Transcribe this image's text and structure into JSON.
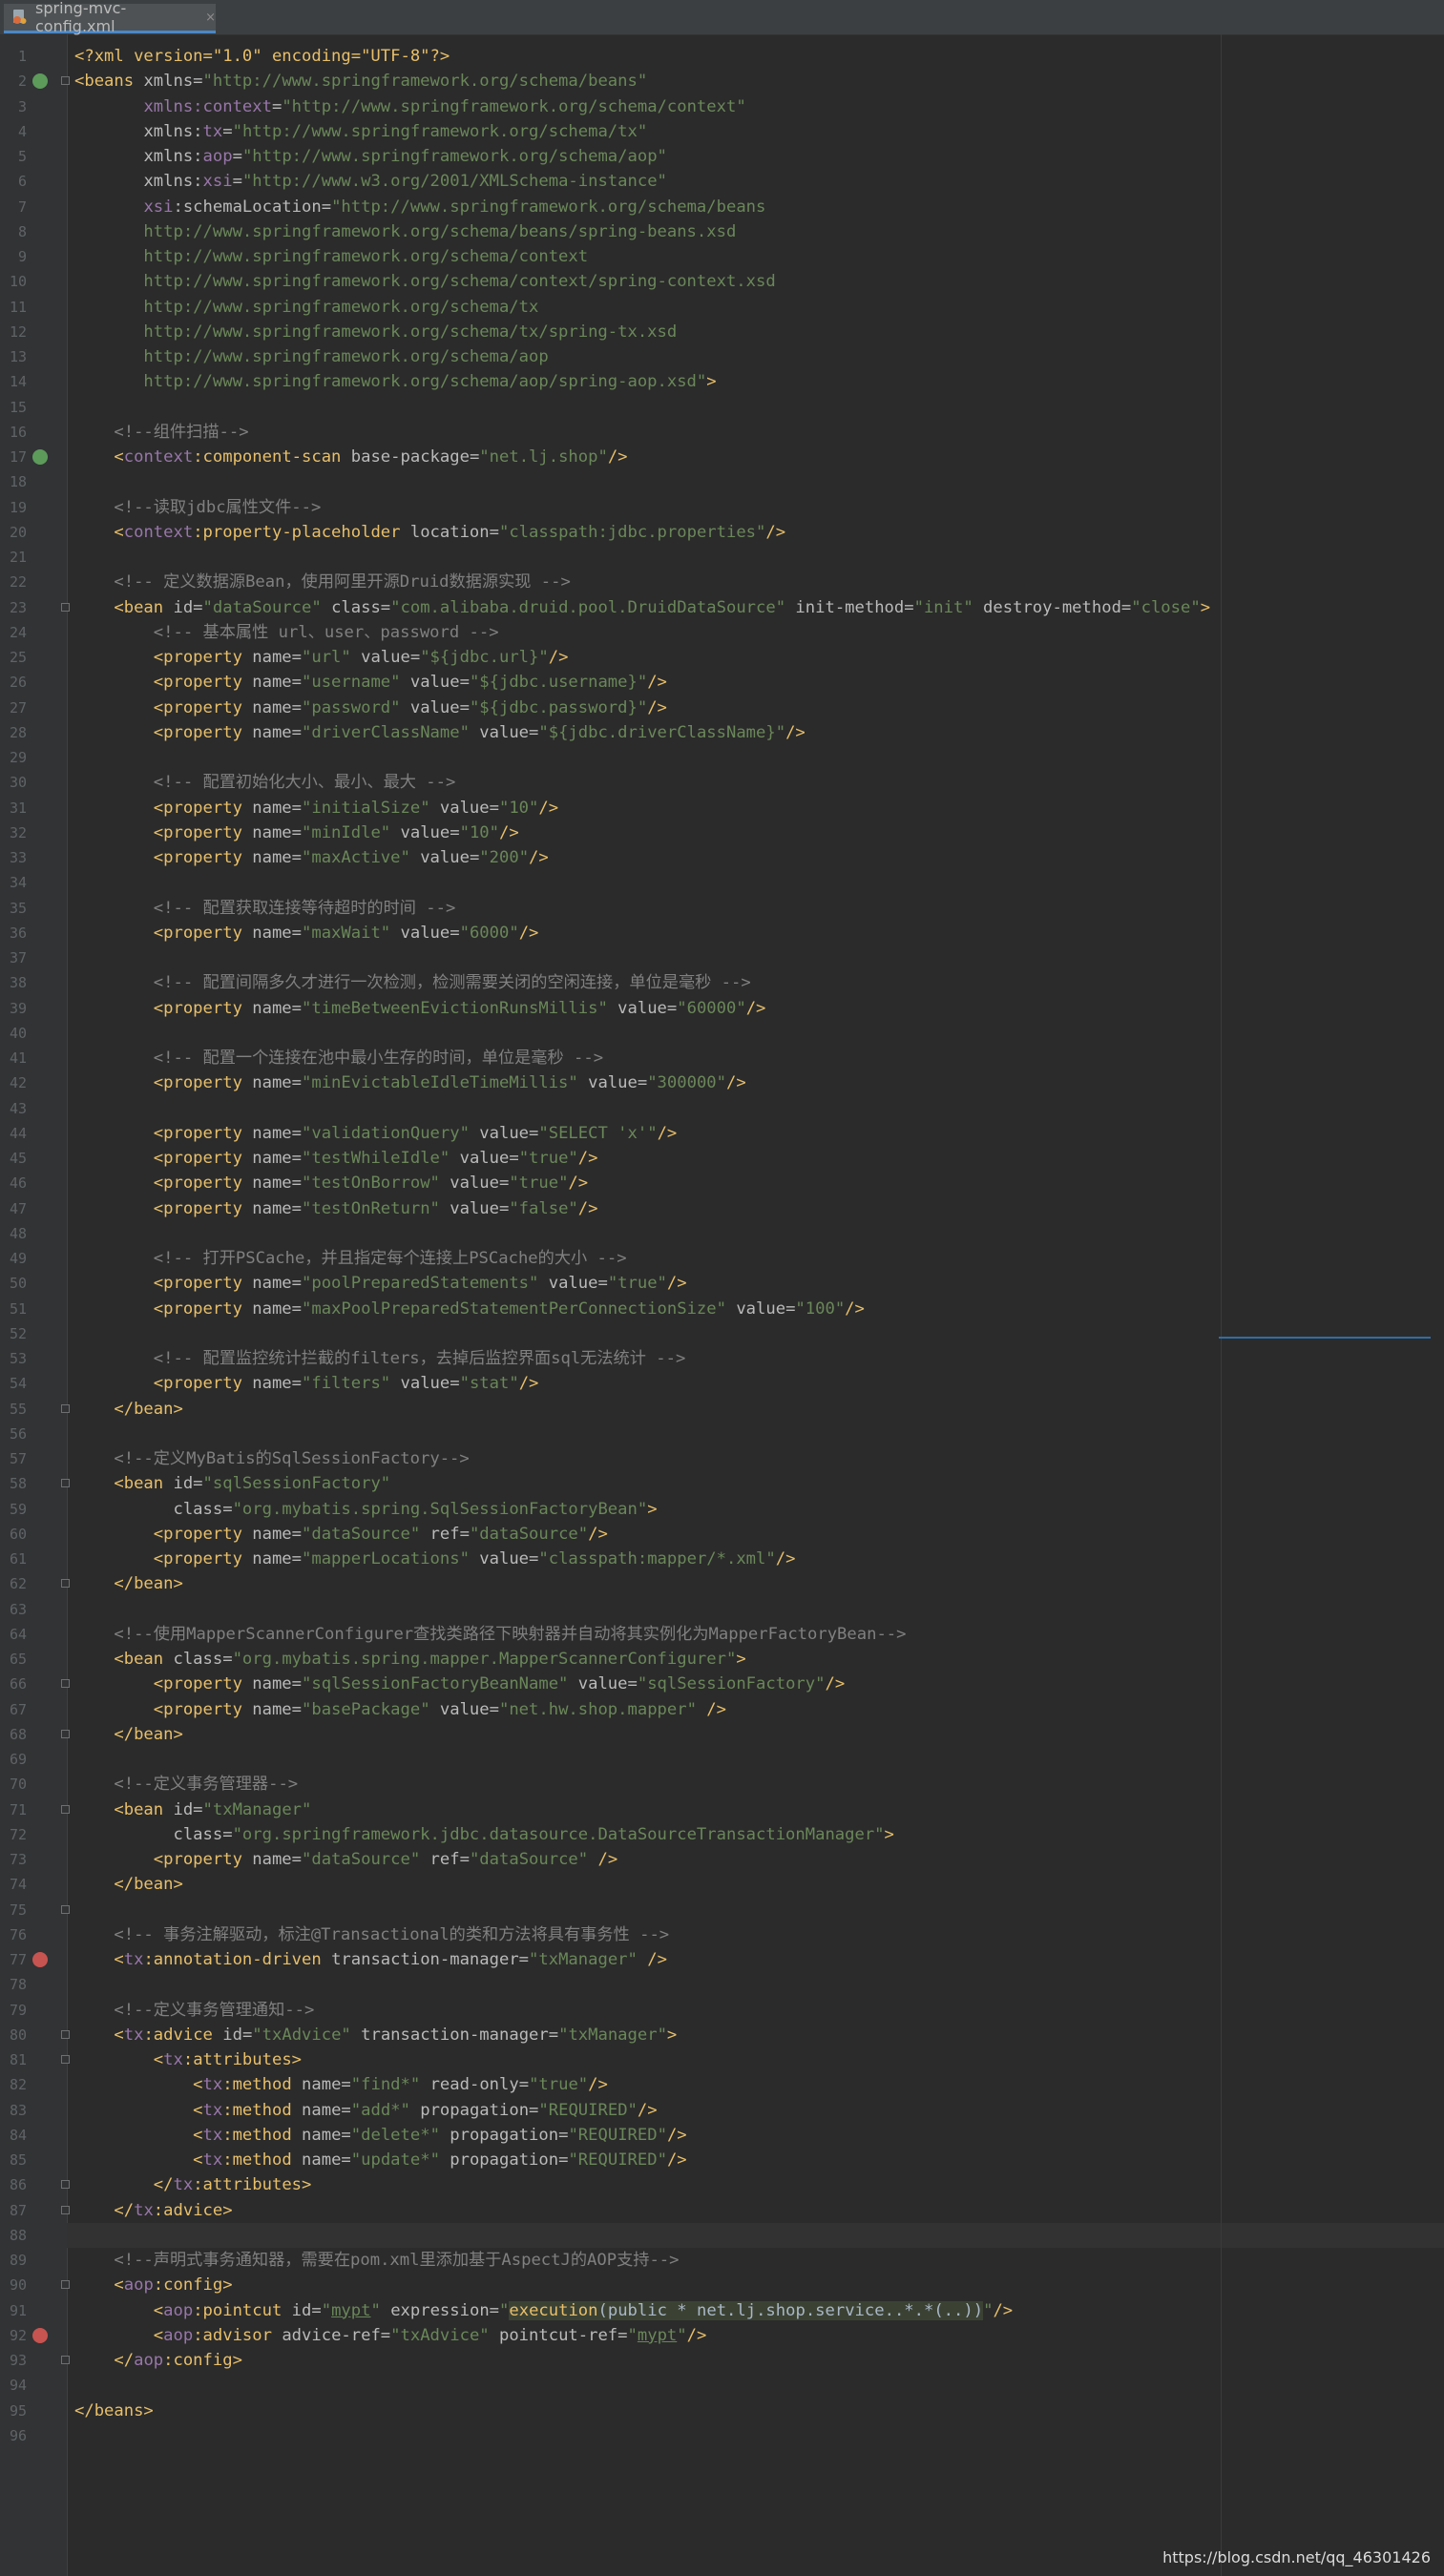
{
  "tab": {
    "filename": "spring-mvc-config.xml",
    "close_glyph": "×"
  },
  "watermark": "https://blog.csdn.net/qq_46301426",
  "current_line": 88,
  "gutter_icons": [
    {
      "line": 2,
      "icon": "bean-mapping-icon",
      "color": "#5d9b5b"
    },
    {
      "line": 17,
      "icon": "spring-bean-icon",
      "color": "#5d9b5b"
    },
    {
      "line": 77,
      "icon": "aop-advice-icon",
      "color": "#c75450"
    },
    {
      "line": 92,
      "icon": "aop-advice-icon",
      "color": "#c75450"
    }
  ],
  "fold_lines": [
    2,
    23,
    55,
    58,
    62,
    66,
    68,
    71,
    75,
    80,
    81,
    86,
    87,
    90,
    93
  ],
  "code_lines": [
    [
      [
        "tg",
        "<?xml version=\"1.0\" encoding=\"UTF-8\"?>"
      ]
    ],
    [
      [
        "tg",
        "<beans "
      ],
      [
        "at",
        "xmlns="
      ],
      [
        "st",
        "\"http://www.springframework.org/schema/beans\""
      ]
    ],
    [
      [
        "pl",
        "       "
      ],
      [
        "ns",
        "xmlns:context"
      ],
      [
        "at",
        "="
      ],
      [
        "st",
        "\"http://www.springframework.org/schema/context\""
      ]
    ],
    [
      [
        "pl",
        "       "
      ],
      [
        "at",
        "xmlns:"
      ],
      [
        "ns",
        "tx"
      ],
      [
        "at",
        "="
      ],
      [
        "st",
        "\"http://www.springframework.org/schema/tx\""
      ]
    ],
    [
      [
        "pl",
        "       "
      ],
      [
        "at",
        "xmlns:"
      ],
      [
        "ns",
        "aop"
      ],
      [
        "at",
        "="
      ],
      [
        "st",
        "\"http://www.springframework.org/schema/aop\""
      ]
    ],
    [
      [
        "pl",
        "       "
      ],
      [
        "at",
        "xmlns:"
      ],
      [
        "ns",
        "xsi"
      ],
      [
        "at",
        "="
      ],
      [
        "st",
        "\"http://www.w3.org/2001/XMLSchema-instance\""
      ]
    ],
    [
      [
        "pl",
        "       "
      ],
      [
        "ns",
        "xsi"
      ],
      [
        "at",
        ":schemaLocation="
      ],
      [
        "st",
        "\"http://www.springframework.org/schema/beans"
      ]
    ],
    [
      [
        "st",
        "       http://www.springframework.org/schema/beans/spring-beans.xsd"
      ]
    ],
    [
      [
        "st",
        "       http://www.springframework.org/schema/context"
      ]
    ],
    [
      [
        "st",
        "       http://www.springframework.org/schema/context/spring-context.xsd"
      ]
    ],
    [
      [
        "st",
        "       http://www.springframework.org/schema/tx"
      ]
    ],
    [
      [
        "st",
        "       http://www.springframework.org/schema/tx/spring-tx.xsd"
      ]
    ],
    [
      [
        "st",
        "       http://www.springframework.org/schema/aop"
      ]
    ],
    [
      [
        "st",
        "       http://www.springframework.org/schema/aop/spring-aop.xsd\""
      ],
      [
        "tg",
        ">"
      ]
    ],
    [],
    [
      [
        "cm",
        "    <!--组件扫描-->"
      ]
    ],
    [
      [
        "tg",
        "    <"
      ],
      [
        "ns",
        "context"
      ],
      [
        "tg",
        ":component-scan "
      ],
      [
        "at",
        "base-package="
      ],
      [
        "st",
        "\"net.lj.shop\""
      ],
      [
        "tg",
        "/>"
      ]
    ],
    [],
    [
      [
        "cm",
        "    <!--读取jdbc属性文件-->"
      ]
    ],
    [
      [
        "tg",
        "    <"
      ],
      [
        "ns",
        "context"
      ],
      [
        "tg",
        ":property-placeholder "
      ],
      [
        "at",
        "location="
      ],
      [
        "st",
        "\"classpath:jdbc.properties\""
      ],
      [
        "tg",
        "/>"
      ]
    ],
    [],
    [
      [
        "cm",
        "    <!-- 定义数据源Bean，使用阿里开源Druid数据源实现 -->"
      ]
    ],
    [
      [
        "tg",
        "    <bean "
      ],
      [
        "at",
        "id="
      ],
      [
        "st",
        "\"dataSource\" "
      ],
      [
        "at",
        "class="
      ],
      [
        "st",
        "\"com.alibaba.druid.pool.DruidDataSource\" "
      ],
      [
        "at",
        "init-method="
      ],
      [
        "st",
        "\"init\" "
      ],
      [
        "at",
        "destroy-method="
      ],
      [
        "st",
        "\"close\""
      ],
      [
        "tg",
        ">"
      ]
    ],
    [
      [
        "cm",
        "        <!-- 基本属性 url、user、password -->"
      ]
    ],
    [
      [
        "tg",
        "        <property "
      ],
      [
        "at",
        "name="
      ],
      [
        "st",
        "\"url\" "
      ],
      [
        "at",
        "value="
      ],
      [
        "st",
        "\"${jdbc.url}\""
      ],
      [
        "tg",
        "/>"
      ]
    ],
    [
      [
        "tg",
        "        <property "
      ],
      [
        "at",
        "name="
      ],
      [
        "st",
        "\"username\" "
      ],
      [
        "at",
        "value="
      ],
      [
        "st",
        "\"${jdbc.username}\""
      ],
      [
        "tg",
        "/>"
      ]
    ],
    [
      [
        "tg",
        "        <property "
      ],
      [
        "at",
        "name="
      ],
      [
        "st",
        "\"password\" "
      ],
      [
        "at",
        "value="
      ],
      [
        "st",
        "\"${jdbc.password}\""
      ],
      [
        "tg",
        "/>"
      ]
    ],
    [
      [
        "tg",
        "        <property "
      ],
      [
        "at",
        "name="
      ],
      [
        "st",
        "\"driverClassName\" "
      ],
      [
        "at",
        "value="
      ],
      [
        "st",
        "\"${jdbc.driverClassName}\""
      ],
      [
        "tg",
        "/>"
      ]
    ],
    [],
    [
      [
        "cm",
        "        <!-- 配置初始化大小、最小、最大 -->"
      ]
    ],
    [
      [
        "tg",
        "        <property "
      ],
      [
        "at",
        "name="
      ],
      [
        "st",
        "\"initialSize\" "
      ],
      [
        "at",
        "value="
      ],
      [
        "st",
        "\"10\""
      ],
      [
        "tg",
        "/>"
      ]
    ],
    [
      [
        "tg",
        "        <property "
      ],
      [
        "at",
        "name="
      ],
      [
        "st",
        "\"minIdle\" "
      ],
      [
        "at",
        "value="
      ],
      [
        "st",
        "\"10\""
      ],
      [
        "tg",
        "/>"
      ]
    ],
    [
      [
        "tg",
        "        <property "
      ],
      [
        "at",
        "name="
      ],
      [
        "st",
        "\"maxActive\" "
      ],
      [
        "at",
        "value="
      ],
      [
        "st",
        "\"200\""
      ],
      [
        "tg",
        "/>"
      ]
    ],
    [],
    [
      [
        "cm",
        "        <!-- 配置获取连接等待超时的时间 -->"
      ]
    ],
    [
      [
        "tg",
        "        <property "
      ],
      [
        "at",
        "name="
      ],
      [
        "st",
        "\"maxWait\" "
      ],
      [
        "at",
        "value="
      ],
      [
        "st",
        "\"6000\""
      ],
      [
        "tg",
        "/>"
      ]
    ],
    [],
    [
      [
        "cm",
        "        <!-- 配置间隔多久才进行一次检测，检测需要关闭的空闲连接，单位是毫秒 -->"
      ]
    ],
    [
      [
        "tg",
        "        <property "
      ],
      [
        "at",
        "name="
      ],
      [
        "st",
        "\"timeBetweenEvictionRunsMillis\" "
      ],
      [
        "at",
        "value="
      ],
      [
        "st",
        "\"60000\""
      ],
      [
        "tg",
        "/>"
      ]
    ],
    [],
    [
      [
        "cm",
        "        <!-- 配置一个连接在池中最小生存的时间，单位是毫秒 -->"
      ]
    ],
    [
      [
        "tg",
        "        <property "
      ],
      [
        "at",
        "name="
      ],
      [
        "st",
        "\"minEvictableIdleTimeMillis\" "
      ],
      [
        "at",
        "value="
      ],
      [
        "st",
        "\"300000\""
      ],
      [
        "tg",
        "/>"
      ]
    ],
    [],
    [
      [
        "tg",
        "        <property "
      ],
      [
        "at",
        "name="
      ],
      [
        "st",
        "\"validationQuery\" "
      ],
      [
        "at",
        "value="
      ],
      [
        "st",
        "\"SELECT 'x'\""
      ],
      [
        "tg",
        "/>"
      ]
    ],
    [
      [
        "tg",
        "        <property "
      ],
      [
        "at",
        "name="
      ],
      [
        "st",
        "\"testWhileIdle\" "
      ],
      [
        "at",
        "value="
      ],
      [
        "st",
        "\"true\""
      ],
      [
        "tg",
        "/>"
      ]
    ],
    [
      [
        "tg",
        "        <property "
      ],
      [
        "at",
        "name="
      ],
      [
        "st",
        "\"testOnBorrow\" "
      ],
      [
        "at",
        "value="
      ],
      [
        "st",
        "\"true\""
      ],
      [
        "tg",
        "/>"
      ]
    ],
    [
      [
        "tg",
        "        <property "
      ],
      [
        "at",
        "name="
      ],
      [
        "st",
        "\"testOnReturn\" "
      ],
      [
        "at",
        "value="
      ],
      [
        "st",
        "\"false\""
      ],
      [
        "tg",
        "/>"
      ]
    ],
    [],
    [
      [
        "cm",
        "        <!-- 打开PSCache，并且指定每个连接上PSCache的大小 -->"
      ]
    ],
    [
      [
        "tg",
        "        <property "
      ],
      [
        "at",
        "name="
      ],
      [
        "st",
        "\"poolPreparedStatements\" "
      ],
      [
        "at",
        "value="
      ],
      [
        "st",
        "\"true\""
      ],
      [
        "tg",
        "/>"
      ]
    ],
    [
      [
        "tg",
        "        <property "
      ],
      [
        "at",
        "name="
      ],
      [
        "st",
        "\"maxPoolPreparedStatementPerConnectionSize\" "
      ],
      [
        "at",
        "value="
      ],
      [
        "st",
        "\"100\""
      ],
      [
        "tg",
        "/>"
      ]
    ],
    [],
    [
      [
        "cm",
        "        <!-- 配置监控统计拦截的filters，去掉后监控界面sql无法统计 -->"
      ]
    ],
    [
      [
        "tg",
        "        <property "
      ],
      [
        "at",
        "name="
      ],
      [
        "st",
        "\"filters\" "
      ],
      [
        "at",
        "value="
      ],
      [
        "st",
        "\"stat\""
      ],
      [
        "tg",
        "/>"
      ]
    ],
    [
      [
        "tg",
        "    </bean>"
      ]
    ],
    [],
    [
      [
        "cm",
        "    <!--定义MyBatis的SqlSessionFactory-->"
      ]
    ],
    [
      [
        "tg",
        "    <bean "
      ],
      [
        "at",
        "id="
      ],
      [
        "st",
        "\"sqlSessionFactory\""
      ]
    ],
    [
      [
        "at",
        "          class="
      ],
      [
        "st",
        "\"org.mybatis.spring.SqlSessionFactoryBean\""
      ],
      [
        "tg",
        ">"
      ]
    ],
    [
      [
        "tg",
        "        <property "
      ],
      [
        "at",
        "name="
      ],
      [
        "st",
        "\"dataSource\" "
      ],
      [
        "at",
        "ref="
      ],
      [
        "st",
        "\"dataSource\""
      ],
      [
        "tg",
        "/>"
      ]
    ],
    [
      [
        "tg",
        "        <property "
      ],
      [
        "at",
        "name="
      ],
      [
        "st",
        "\"mapperLocations\" "
      ],
      [
        "at",
        "value="
      ],
      [
        "st",
        "\"classpath:mapper/*.xml\""
      ],
      [
        "tg",
        "/>"
      ]
    ],
    [
      [
        "tg",
        "    </bean>"
      ]
    ],
    [],
    [
      [
        "cm",
        "    <!--使用MapperScannerConfigurer查找类路径下映射器并自动将其实例化为MapperFactoryBean-->"
      ]
    ],
    [
      [
        "tg",
        "    <bean "
      ],
      [
        "at",
        "class="
      ],
      [
        "st",
        "\"org.mybatis.spring.mapper.MapperScannerConfigurer\""
      ],
      [
        "tg",
        ">"
      ]
    ],
    [
      [
        "tg",
        "        <property "
      ],
      [
        "at",
        "name="
      ],
      [
        "st",
        "\"sqlSessionFactoryBeanName\" "
      ],
      [
        "at",
        "value="
      ],
      [
        "st",
        "\"sqlSessionFactory\""
      ],
      [
        "tg",
        "/>"
      ]
    ],
    [
      [
        "tg",
        "        <property "
      ],
      [
        "at",
        "name="
      ],
      [
        "st",
        "\"basePackage\" "
      ],
      [
        "at",
        "value="
      ],
      [
        "st",
        "\"net.hw.shop.mapper\" "
      ],
      [
        "tg",
        "/>"
      ]
    ],
    [
      [
        "tg",
        "    </bean>"
      ]
    ],
    [],
    [
      [
        "cm",
        "    <!--定义事务管理器-->"
      ]
    ],
    [
      [
        "tg",
        "    <bean "
      ],
      [
        "at",
        "id="
      ],
      [
        "st",
        "\"txManager\""
      ]
    ],
    [
      [
        "at",
        "          class="
      ],
      [
        "st",
        "\"org.springframework.jdbc.datasource.DataSourceTransactionManager\""
      ],
      [
        "tg",
        ">"
      ]
    ],
    [
      [
        "tg",
        "        <property "
      ],
      [
        "at",
        "name="
      ],
      [
        "st",
        "\"dataSource\" "
      ],
      [
        "at",
        "ref="
      ],
      [
        "st",
        "\"dataSource\" "
      ],
      [
        "tg",
        "/>"
      ]
    ],
    [
      [
        "tg",
        "    </bean>"
      ]
    ],
    [],
    [
      [
        "cm",
        "    <!-- 事务注解驱动，标注@Transactional的类和方法将具有事务性 -->"
      ]
    ],
    [
      [
        "tg",
        "    <"
      ],
      [
        "ns",
        "tx"
      ],
      [
        "tg",
        ":annotation-driven "
      ],
      [
        "at",
        "transaction-manager="
      ],
      [
        "st",
        "\"txManager\" "
      ],
      [
        "tg",
        "/>"
      ]
    ],
    [],
    [
      [
        "cm",
        "    <!--定义事务管理通知-->"
      ]
    ],
    [
      [
        "tg",
        "    <"
      ],
      [
        "ns",
        "tx"
      ],
      [
        "tg",
        ":advice "
      ],
      [
        "at",
        "id="
      ],
      [
        "st",
        "\"txAdvice\" "
      ],
      [
        "at",
        "transaction-manager="
      ],
      [
        "st",
        "\"txManager\""
      ],
      [
        "tg",
        ">"
      ]
    ],
    [
      [
        "tg",
        "        <"
      ],
      [
        "ns",
        "tx"
      ],
      [
        "tg",
        ":attributes>"
      ]
    ],
    [
      [
        "tg",
        "            <"
      ],
      [
        "ns",
        "tx"
      ],
      [
        "tg",
        ":method "
      ],
      [
        "at",
        "name="
      ],
      [
        "st",
        "\"find*\" "
      ],
      [
        "at",
        "read-only="
      ],
      [
        "st",
        "\"true\""
      ],
      [
        "tg",
        "/>"
      ]
    ],
    [
      [
        "tg",
        "            <"
      ],
      [
        "ns",
        "tx"
      ],
      [
        "tg",
        ":method "
      ],
      [
        "at",
        "name="
      ],
      [
        "st",
        "\"add*\" "
      ],
      [
        "at",
        "propagation="
      ],
      [
        "st",
        "\"REQUIRED\""
      ],
      [
        "tg",
        "/>"
      ]
    ],
    [
      [
        "tg",
        "            <"
      ],
      [
        "ns",
        "tx"
      ],
      [
        "tg",
        ":method "
      ],
      [
        "at",
        "name="
      ],
      [
        "st",
        "\"delete*\" "
      ],
      [
        "at",
        "propagation="
      ],
      [
        "st",
        "\"REQUIRED\""
      ],
      [
        "tg",
        "/>"
      ]
    ],
    [
      [
        "tg",
        "            <"
      ],
      [
        "ns",
        "tx"
      ],
      [
        "tg",
        ":method "
      ],
      [
        "at",
        "name="
      ],
      [
        "st",
        "\"update*\" "
      ],
      [
        "at",
        "propagation="
      ],
      [
        "st",
        "\"REQUIRED\""
      ],
      [
        "tg",
        "/>"
      ]
    ],
    [
      [
        "tg",
        "        </"
      ],
      [
        "ns",
        "tx"
      ],
      [
        "tg",
        ":attributes>"
      ]
    ],
    [
      [
        "tg",
        "    </"
      ],
      [
        "ns",
        "tx"
      ],
      [
        "tg",
        ":advice>"
      ]
    ],
    [],
    [
      [
        "cm",
        "    <!--声明式事务通知器，需要在pom.xml里添加基于AspectJ的AOP支持-->"
      ]
    ],
    [
      [
        "tg",
        "    <"
      ],
      [
        "ns",
        "aop"
      ],
      [
        "tg",
        ":config>"
      ]
    ],
    [
      [
        "tg",
        "        <"
      ],
      [
        "ns",
        "aop"
      ],
      [
        "tg",
        ":pointcut "
      ],
      [
        "at",
        "id="
      ],
      [
        "st",
        "\""
      ],
      [
        "st ul",
        "mypt"
      ],
      [
        "st",
        "\" "
      ],
      [
        "at",
        "expression="
      ],
      [
        "st",
        "\""
      ],
      [
        "tg hl",
        "execution"
      ],
      [
        "pl hl",
        "(public * net.lj.shop.service..*.*(..))"
      ],
      [
        "st",
        "\""
      ],
      [
        "tg",
        "/>"
      ]
    ],
    [
      [
        "tg",
        "        <"
      ],
      [
        "ns",
        "aop"
      ],
      [
        "tg",
        ":advisor "
      ],
      [
        "at",
        "advice-ref="
      ],
      [
        "st",
        "\"txAdvice\" "
      ],
      [
        "at",
        "pointcut-ref="
      ],
      [
        "st",
        "\""
      ],
      [
        "st ul",
        "mypt"
      ],
      [
        "st",
        "\""
      ],
      [
        "tg",
        "/>"
      ]
    ],
    [
      [
        "tg",
        "    </"
      ],
      [
        "ns",
        "aop"
      ],
      [
        "tg",
        ":config>"
      ]
    ],
    [],
    [
      [
        "tg",
        "</beans>"
      ]
    ],
    []
  ]
}
